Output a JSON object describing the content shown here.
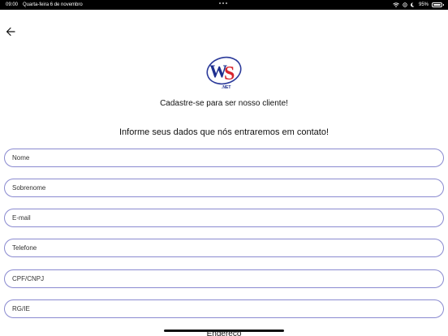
{
  "status_bar": {
    "time": "09:00",
    "date": "Quarta-feira 6 de novembro",
    "battery": "95%",
    "battery_level": 0.95
  },
  "header": {
    "back_icon": "arrow-left-icon"
  },
  "logo": {
    "letters": "WS",
    "suffix": ".NET",
    "colors": {
      "w": "#1e2f8f",
      "s": "#d8262e",
      "swoosh": "#2b3a9a"
    }
  },
  "content": {
    "subtitle": "Cadastre-se para ser nosso cliente!",
    "info_text": "Informe seus dados que nós entraremos em contato!",
    "section_label": "Endereço"
  },
  "form": {
    "fields": [
      {
        "placeholder": "Nome",
        "value": ""
      },
      {
        "placeholder": "Sobrenome",
        "value": ""
      },
      {
        "placeholder": "E-mail",
        "value": ""
      },
      {
        "placeholder": "Telefone",
        "value": ""
      },
      {
        "placeholder": "CPF/CNPJ",
        "value": ""
      },
      {
        "placeholder": "RG/IE",
        "value": ""
      }
    ]
  },
  "colors": {
    "field_border": "#8a8ad0"
  }
}
